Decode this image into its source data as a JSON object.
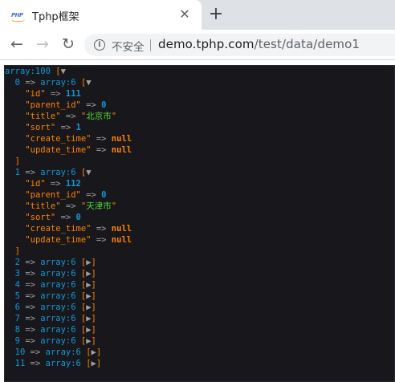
{
  "tab": {
    "title": "Tphp框架",
    "favicon_text": "PHP",
    "close": "✕",
    "new_tab": "+"
  },
  "toolbar": {
    "back": "←",
    "forward": "→",
    "reload": "↻",
    "security_icon": "i",
    "security_text": "不安全",
    "url_host": "demo.tphp.com",
    "url_path": "/test/data/demo1"
  },
  "dump": {
    "root_label": "array:100",
    "root_open": "[",
    "expanded": [
      {
        "index": "0",
        "type": "array:6",
        "fields": [
          {
            "key": "\"id\"",
            "value": "111",
            "kind": "num"
          },
          {
            "key": "\"parent_id\"",
            "value": "0",
            "kind": "num"
          },
          {
            "key": "\"title\"",
            "value": "北京市",
            "kind": "str"
          },
          {
            "key": "\"sort\"",
            "value": "1",
            "kind": "num"
          },
          {
            "key": "\"create_time\"",
            "value": "null",
            "kind": "null"
          },
          {
            "key": "\"update_time\"",
            "value": "null",
            "kind": "null"
          }
        ]
      },
      {
        "index": "1",
        "type": "array:6",
        "fields": [
          {
            "key": "\"id\"",
            "value": "112",
            "kind": "num"
          },
          {
            "key": "\"parent_id\"",
            "value": "0",
            "kind": "num"
          },
          {
            "key": "\"title\"",
            "value": "天津市",
            "kind": "str"
          },
          {
            "key": "\"sort\"",
            "value": "0",
            "kind": "num"
          },
          {
            "key": "\"create_time\"",
            "value": "null",
            "kind": "null"
          },
          {
            "key": "\"update_time\"",
            "value": "null",
            "kind": "null"
          }
        ]
      }
    ],
    "collapsed": [
      {
        "index": "2",
        "type": "array:6"
      },
      {
        "index": "3",
        "type": "array:6"
      },
      {
        "index": "4",
        "type": "array:6"
      },
      {
        "index": "5",
        "type": "array:6"
      },
      {
        "index": "6",
        "type": "array:6"
      },
      {
        "index": "7",
        "type": "array:6"
      },
      {
        "index": "8",
        "type": "array:6"
      },
      {
        "index": "9",
        "type": "array:6"
      },
      {
        "index": "10",
        "type": "array:6"
      },
      {
        "index": "11",
        "type": "array:6"
      }
    ],
    "arrow": "=>",
    "close_bracket": "]",
    "toggle_open": "▼",
    "toggle_closed": "▶"
  }
}
